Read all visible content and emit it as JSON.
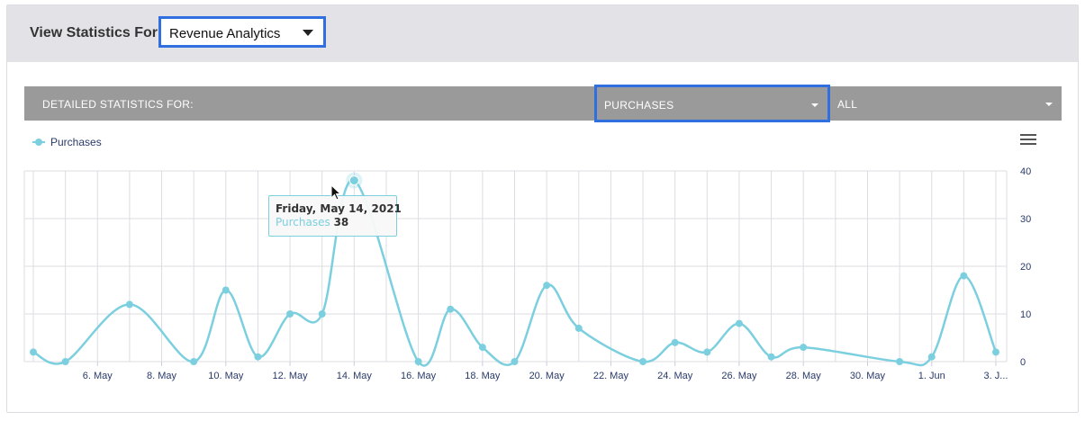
{
  "header": {
    "view_label": "View Statistics For",
    "metric_select": {
      "value": "Revenue Analytics"
    }
  },
  "stats_bar": {
    "label": "DETAILED STATISTICS FOR:",
    "type_select": {
      "value": "PURCHASES"
    },
    "filter_select": {
      "value": "ALL"
    }
  },
  "colors": {
    "series": "#7ccfdf",
    "grid": "#dcdde2",
    "accent_border": "#2f6fdf"
  },
  "chart_data": {
    "type": "line",
    "legend": "top-left",
    "series": [
      {
        "name": "Purchases",
        "values": [
          2,
          0,
          12,
          0,
          15,
          1,
          10,
          10,
          38,
          0,
          11,
          3,
          0,
          16,
          7,
          0,
          4,
          2,
          8,
          1,
          3,
          0,
          1,
          18,
          2
        ]
      }
    ],
    "x": [
      "2021-05-04",
      "2021-05-05",
      "2021-05-07",
      "2021-05-09",
      "2021-05-10",
      "2021-05-11",
      "2021-05-12",
      "2021-05-13",
      "2021-05-14",
      "2021-05-16",
      "2021-05-17",
      "2021-05-18",
      "2021-05-19",
      "2021-05-20",
      "2021-05-21",
      "2021-05-23",
      "2021-05-24",
      "2021-05-25",
      "2021-05-26",
      "2021-05-27",
      "2021-05-28",
      "2021-05-31",
      "2021-06-01",
      "2021-06-02",
      "2021-06-03"
    ],
    "xlim": [
      "2021-05-04",
      "2021-06-03"
    ],
    "x_ticks": [
      "6. May",
      "8. May",
      "10. May",
      "12. May",
      "14. May",
      "16. May",
      "18. May",
      "20. May",
      "22. May",
      "24. May",
      "26. May",
      "28. May",
      "30. May",
      "1. Jun",
      "3. J..."
    ],
    "y_ticks": [
      "0",
      "10",
      "20",
      "30",
      "40"
    ],
    "ylim": [
      0,
      40
    ],
    "grid": true,
    "tooltip": {
      "date": "Friday, May 14, 2021",
      "series": "Purchases",
      "value": "38"
    }
  }
}
